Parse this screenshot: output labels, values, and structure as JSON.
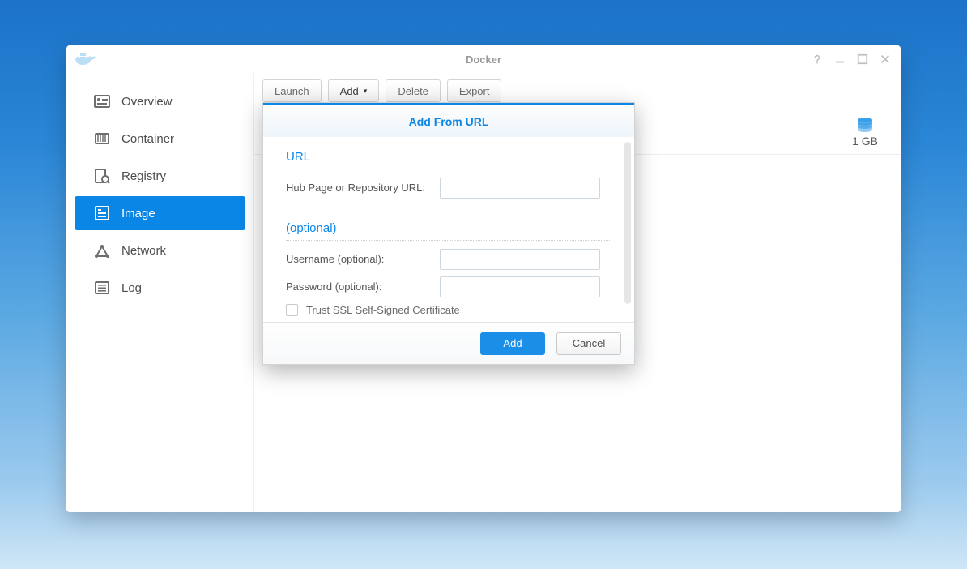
{
  "window": {
    "title": "Docker"
  },
  "sidebar": {
    "items": [
      {
        "label": "Overview",
        "icon": "overview",
        "selected": false
      },
      {
        "label": "Container",
        "icon": "container",
        "selected": false
      },
      {
        "label": "Registry",
        "icon": "registry",
        "selected": false
      },
      {
        "label": "Image",
        "icon": "image",
        "selected": true
      },
      {
        "label": "Network",
        "icon": "network",
        "selected": false
      },
      {
        "label": "Log",
        "icon": "log",
        "selected": false
      }
    ]
  },
  "toolbar": {
    "launch": "Launch",
    "add": "Add",
    "delete": "Delete",
    "export": "Export"
  },
  "summary": {
    "size": "1 GB"
  },
  "dialog": {
    "title": "Add From URL",
    "section_url": "URL",
    "url_label": "Hub Page or Repository URL:",
    "url_value": "",
    "section_optional": "(optional)",
    "username_label": "Username (optional):",
    "username_value": "",
    "password_label": "Password (optional):",
    "password_value": "",
    "trust_ssl_label": "Trust SSL Self-Signed Certificate",
    "add": "Add",
    "cancel": "Cancel"
  }
}
